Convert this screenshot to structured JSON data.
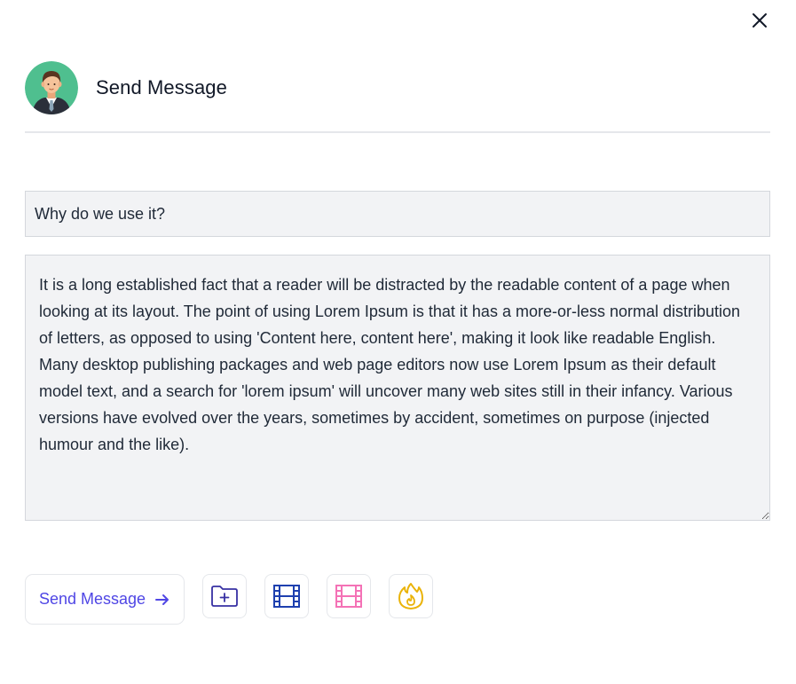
{
  "dialog": {
    "title": "Send Message",
    "close_icon": "close-icon"
  },
  "form": {
    "subject_value": "Why do we use it?",
    "message_value": "It is a long established fact that a reader will be distracted by the readable content of a page when looking at its layout. The point of using Lorem Ipsum is that it has a more-or-less normal distribution of letters, as opposed to using 'Content here, content here', making it look like readable English. Many desktop publishing packages and web page editors now use Lorem Ipsum as their default model text, and a search for 'lorem ipsum' will uncover many web sites still in their infancy. Various versions have evolved over the years, sometimes by accident, sometimes on purpose (injected humour and the like)."
  },
  "actions": {
    "send_label": "Send Message",
    "send_icon": "arrow-right-icon",
    "buttons": [
      {
        "icon": "folder-plus-icon",
        "color": "#3730a3"
      },
      {
        "icon": "film-icon",
        "color": "#1e40af"
      },
      {
        "icon": "film-icon",
        "color": "#f472b6"
      },
      {
        "icon": "fire-icon",
        "color": "#eab308"
      }
    ]
  },
  "colors": {
    "accent": "#4f46e5",
    "field_bg": "#f2f3f5",
    "border": "#e5e7eb"
  }
}
